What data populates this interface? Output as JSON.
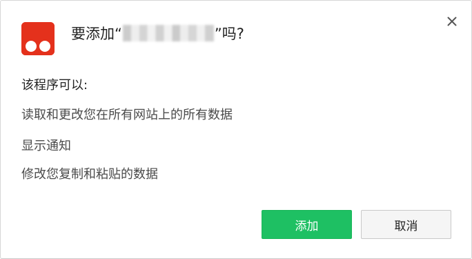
{
  "dialog": {
    "title_prefix": "要添加“",
    "title_suffix": "”吗?",
    "extension_icon": "extension-app-icon",
    "close_icon": "close-icon",
    "permissions_heading": "该程序可以:",
    "permissions": [
      "读取和更改您在所有网站上的所有数据",
      "显示通知",
      "修改您复制和粘贴的数据"
    ],
    "add_label": "添加",
    "cancel_label": "取消"
  },
  "colors": {
    "icon_red": "#e4311c",
    "add_green": "#1ec063",
    "cancel_gray": "#f5f5f5"
  }
}
